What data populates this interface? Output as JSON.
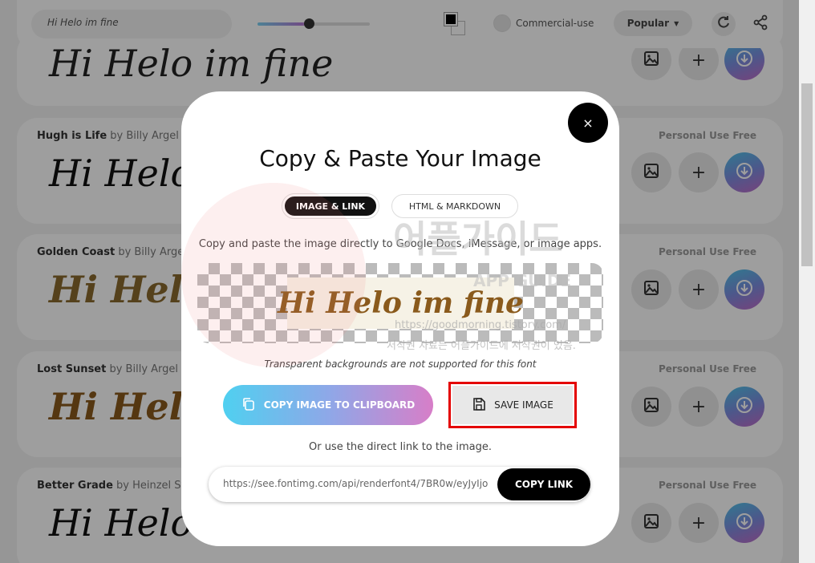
{
  "toolbar": {
    "preview_text": "Hi Helo im fine",
    "commercial_label": "Commercial-use",
    "sort_label": "Popular"
  },
  "fonts": [
    {
      "name": "",
      "author": "",
      "badge": "",
      "preview": "Hi Helo im fine",
      "color": "#222222"
    },
    {
      "name": "Hugh is Life",
      "author": "by Billy Argel",
      "badge": "Personal Use Free",
      "preview": "Hi Helo",
      "color": "#111111"
    },
    {
      "name": "Golden Coast",
      "author": "by Billy Argel",
      "badge": "Personal Use Free",
      "preview": "Hi Helo",
      "color": "#8a6a2e"
    },
    {
      "name": "Lost Sunset",
      "author": "by Billy Argel",
      "badge": "Personal Use Free",
      "preview": "Hi Hel",
      "color": "#8a5a1c"
    },
    {
      "name": "Better Grade",
      "author": "by Heinzel Stud",
      "badge": "Personal Use Free",
      "preview": "Hi Helo im",
      "color": "#111111"
    }
  ],
  "modal": {
    "title": "Copy & Paste Your Image",
    "tab_image_link": "IMAGE & LINK",
    "tab_html_markdown": "HTML & MARKDOWN",
    "description": "Copy and paste the image directly to Google Docs, iMessage, or image apps.",
    "image_text": "Hi Helo im fine",
    "transparent_note": "Transparent backgrounds are not supported for this font",
    "copy_image_label": "COPY IMAGE TO CLIPBOARD",
    "save_image_label": "SAVE IMAGE",
    "or_text": "Or use the direct link to the image.",
    "link_url": "https://see.fontimg.com/api/renderfont4/7BR0w/eyJyIjo",
    "copy_link_label": "COPY LINK",
    "close_symbol": "×"
  },
  "watermark": {
    "title": "어플가이드",
    "sub": "APP GUIDE",
    "url": "https://goodmorning.tistory.com/",
    "note": "저작권 자료는 어플가이드에 저작권이 있음."
  },
  "colors": {
    "highlight": "#e40000",
    "accent_start": "#4fd0f0",
    "accent_end": "#d77ec8"
  }
}
